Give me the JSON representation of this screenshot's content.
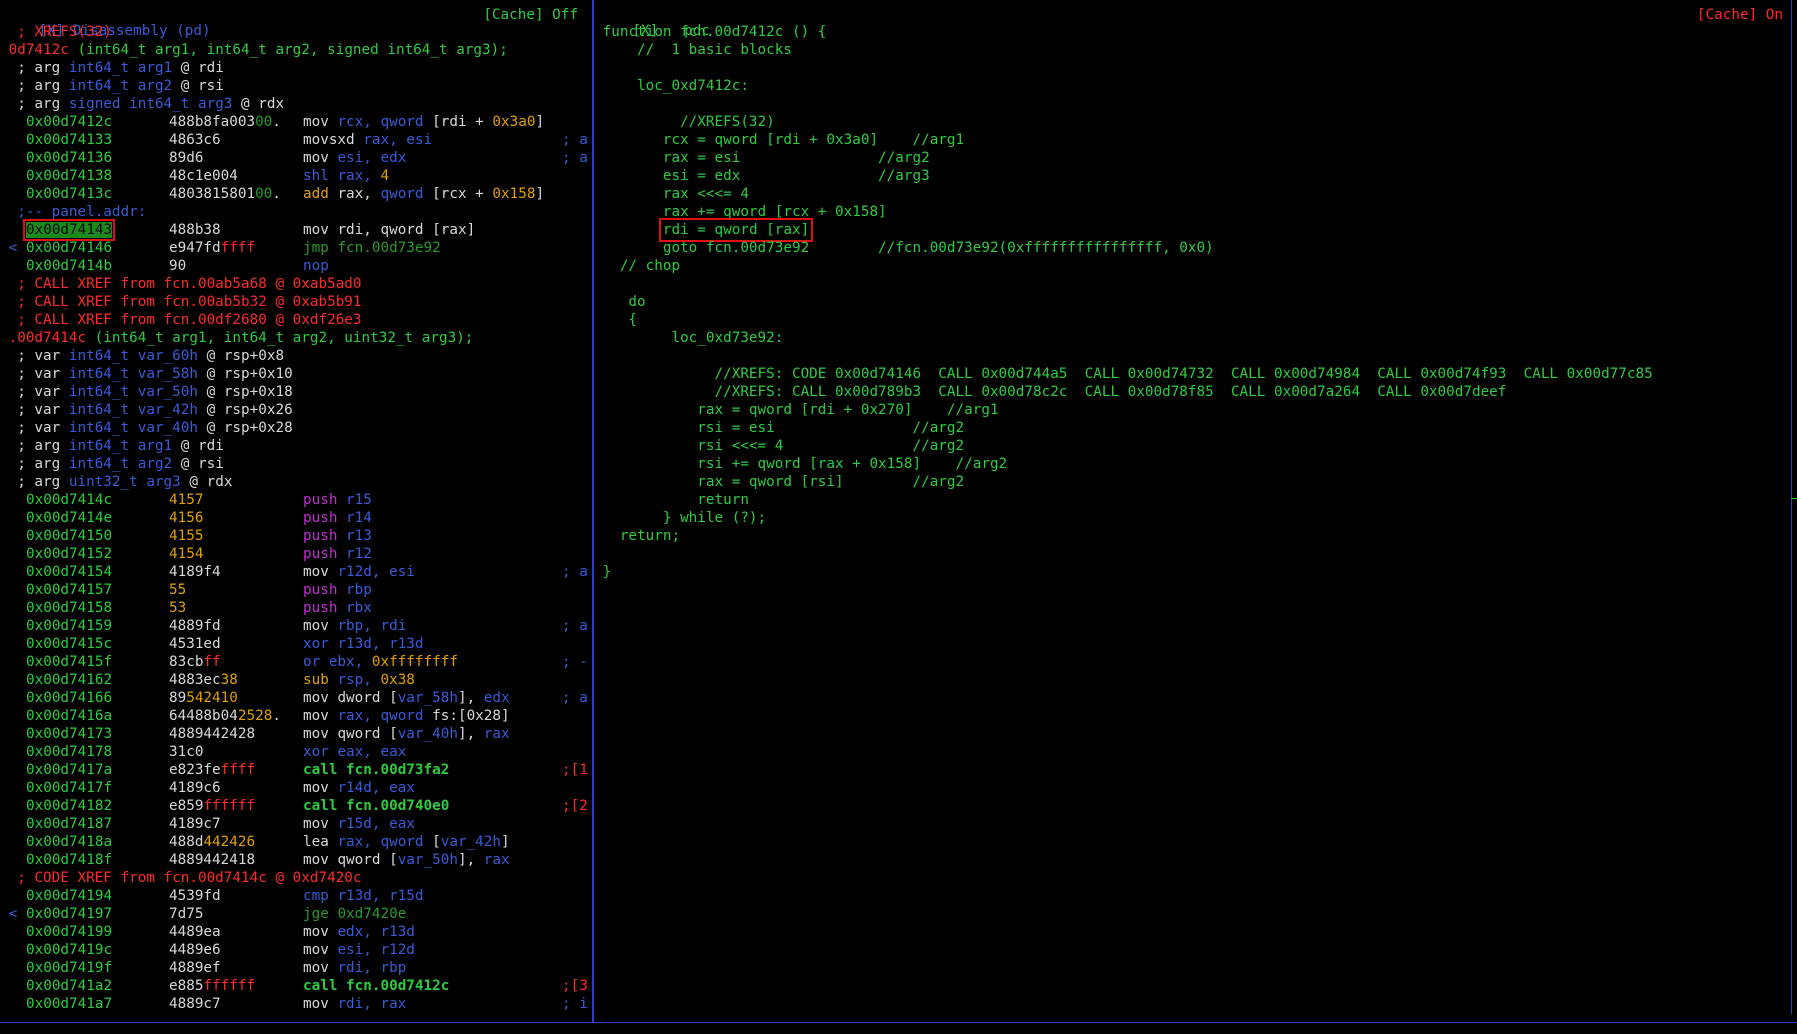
{
  "left_panel": {
    "title": "[X] Disassembly (pd)",
    "cache": "[Cache] Off",
    "lines": [
      {
        "t": "raw",
        "text": "  ; XREFS(32)",
        "c": "r"
      },
      {
        "t": "sig",
        "name": " 0d7412c",
        "rest": " (int64_t arg1, int64_t arg2, signed int64_t arg3);"
      },
      {
        "t": "arg",
        "pre": "  ; arg ",
        "typ": "int64_t arg1",
        "post": " @ rdi"
      },
      {
        "t": "arg",
        "pre": "  ; arg ",
        "typ": "int64_t arg2",
        "post": " @ rsi"
      },
      {
        "t": "arg",
        "pre": "  ; arg ",
        "typ": "signed int64_t arg3",
        "post": " @ rdx"
      },
      {
        "t": "ins",
        "mark": "",
        "addr": "0x00d7412c",
        "bytes": [
          [
            "488b8fa003",
            "w"
          ],
          [
            "00",
            "dg"
          ],
          [
            ".",
            "w"
          ]
        ],
        "op": [
          [
            "mov ",
            "w"
          ],
          [
            "rcx, ",
            "b"
          ],
          [
            "qword ",
            "b"
          ],
          [
            "[rdi + ",
            "w"
          ],
          [
            "0x3a0",
            "y"
          ],
          [
            "]",
            "w"
          ]
        ],
        "cm": ""
      },
      {
        "t": "ins",
        "mark": "",
        "addr": "0x00d74133",
        "bytes": [
          [
            "4863c6",
            "w"
          ]
        ],
        "op": [
          [
            "movsxd ",
            "w"
          ],
          [
            "rax, esi",
            "b"
          ]
        ],
        "cm": "; a"
      },
      {
        "t": "ins",
        "mark": "",
        "addr": "0x00d74136",
        "bytes": [
          [
            "89d6",
            "w"
          ]
        ],
        "op": [
          [
            "mov ",
            "w"
          ],
          [
            "esi, edx",
            "b"
          ]
        ],
        "cm": "; a"
      },
      {
        "t": "ins",
        "mark": "",
        "addr": "0x00d74138",
        "bytes": [
          [
            "48c1e004",
            "w"
          ]
        ],
        "op": [
          [
            "shl ",
            "b"
          ],
          [
            "rax, ",
            "b"
          ],
          [
            "4",
            "y"
          ]
        ],
        "cm": ""
      },
      {
        "t": "ins",
        "mark": "",
        "addr": "0x00d7413c",
        "bytes": [
          [
            "4803815801",
            "w"
          ],
          [
            "00",
            "dg"
          ],
          [
            ".",
            "w"
          ]
        ],
        "op": [
          [
            "add ",
            "y"
          ],
          [
            "rax, ",
            "w"
          ],
          [
            "qword ",
            "b"
          ],
          [
            "[rcx + ",
            "w"
          ],
          [
            "0x158",
            "y"
          ],
          [
            "]",
            "w"
          ]
        ],
        "cm": ""
      },
      {
        "t": "raw",
        "text": "  ;-- panel.addr:",
        "c": "b"
      },
      {
        "t": "ins",
        "mark": "",
        "addr": "0x00d74143",
        "sel": true,
        "bytes": [
          [
            "488b38",
            "w"
          ]
        ],
        "op": [
          [
            "mov ",
            "w"
          ],
          [
            "rdi, ",
            "w"
          ],
          [
            "qword ",
            "w"
          ],
          [
            "[rax]",
            "w"
          ]
        ],
        "cm": ""
      },
      {
        "t": "ins",
        "mark": "<",
        "addr": "0x00d74146",
        "bytes": [
          [
            "e947fd",
            "w"
          ],
          [
            "ffff",
            "r"
          ]
        ],
        "op": [
          [
            "jmp ",
            "dg"
          ],
          [
            "fcn.00d73e92",
            "dg"
          ]
        ],
        "cm": ""
      },
      {
        "t": "ins",
        "mark": "",
        "addr": "0x00d7414b",
        "bytes": [
          [
            "90",
            "w"
          ]
        ],
        "op": [
          [
            "nop",
            "b"
          ]
        ],
        "cm": ""
      },
      {
        "t": "raw",
        "text": "  ; CALL XREF from fcn.00ab5a68 @ 0xab5ad0",
        "c": "r"
      },
      {
        "t": "raw",
        "text": "  ; CALL XREF from fcn.00ab5b32 @ 0xab5b91",
        "c": "r"
      },
      {
        "t": "raw",
        "text": "  ; CALL XREF from fcn.00df2680 @ 0xdf26e3",
        "c": "r"
      },
      {
        "t": "sig",
        "name": " .00d7414c",
        "rest": " (int64_t arg1, int64_t arg2, uint32_t arg3);"
      },
      {
        "t": "arg",
        "pre": "  ; var ",
        "typ": "int64_t var_60h",
        "post": " @ rsp+0x8"
      },
      {
        "t": "arg",
        "pre": "  ; var ",
        "typ": "int64_t var_58h",
        "post": " @ rsp+0x10"
      },
      {
        "t": "arg",
        "pre": "  ; var ",
        "typ": "int64_t var_50h",
        "post": " @ rsp+0x18"
      },
      {
        "t": "arg",
        "pre": "  ; var ",
        "typ": "int64_t var_42h",
        "post": " @ rsp+0x26"
      },
      {
        "t": "arg",
        "pre": "  ; var ",
        "typ": "int64_t var_40h",
        "post": " @ rsp+0x28"
      },
      {
        "t": "arg",
        "pre": "  ; arg ",
        "typ": "int64_t arg1",
        "post": " @ rdi"
      },
      {
        "t": "arg",
        "pre": "  ; arg ",
        "typ": "int64_t arg2",
        "post": " @ rsi"
      },
      {
        "t": "arg",
        "pre": "  ; arg ",
        "typ": "uint32_t arg3",
        "post": " @ rdx"
      },
      {
        "t": "ins",
        "mark": "",
        "addr": "0x00d7414c",
        "bytes": [
          [
            "4157",
            "y"
          ]
        ],
        "op": [
          [
            "push ",
            "p"
          ],
          [
            "r15",
            "b"
          ]
        ],
        "cm": ""
      },
      {
        "t": "ins",
        "mark": "",
        "addr": "0x00d7414e",
        "bytes": [
          [
            "4156",
            "y"
          ]
        ],
        "op": [
          [
            "push ",
            "p"
          ],
          [
            "r14",
            "b"
          ]
        ],
        "cm": ""
      },
      {
        "t": "ins",
        "mark": "",
        "addr": "0x00d74150",
        "bytes": [
          [
            "4155",
            "y"
          ]
        ],
        "op": [
          [
            "push ",
            "p"
          ],
          [
            "r13",
            "b"
          ]
        ],
        "cm": ""
      },
      {
        "t": "ins",
        "mark": "",
        "addr": "0x00d74152",
        "bytes": [
          [
            "4154",
            "y"
          ]
        ],
        "op": [
          [
            "push ",
            "p"
          ],
          [
            "r12",
            "b"
          ]
        ],
        "cm": ""
      },
      {
        "t": "ins",
        "mark": "",
        "addr": "0x00d74154",
        "bytes": [
          [
            "4189f4",
            "w"
          ]
        ],
        "op": [
          [
            "mov ",
            "w"
          ],
          [
            "r12d, esi",
            "b"
          ]
        ],
        "cm": "; a"
      },
      {
        "t": "ins",
        "mark": "",
        "addr": "0x00d74157",
        "bytes": [
          [
            "55",
            "y"
          ]
        ],
        "op": [
          [
            "push ",
            "p"
          ],
          [
            "rbp",
            "b"
          ]
        ],
        "cm": ""
      },
      {
        "t": "ins",
        "mark": "",
        "addr": "0x00d74158",
        "bytes": [
          [
            "53",
            "y"
          ]
        ],
        "op": [
          [
            "push ",
            "p"
          ],
          [
            "rbx",
            "b"
          ]
        ],
        "cm": ""
      },
      {
        "t": "ins",
        "mark": "",
        "addr": "0x00d74159",
        "bytes": [
          [
            "4889fd",
            "w"
          ]
        ],
        "op": [
          [
            "mov ",
            "w"
          ],
          [
            "rbp, rdi",
            "b"
          ]
        ],
        "cm": "; a"
      },
      {
        "t": "ins",
        "mark": "",
        "addr": "0x00d7415c",
        "bytes": [
          [
            "4531ed",
            "w"
          ]
        ],
        "op": [
          [
            "xor ",
            "b"
          ],
          [
            "r13d, r13d",
            "b"
          ]
        ],
        "cm": ""
      },
      {
        "t": "ins",
        "mark": "",
        "addr": "0x00d7415f",
        "bytes": [
          [
            "83cb",
            "w"
          ],
          [
            "ff",
            "r"
          ]
        ],
        "op": [
          [
            "or ",
            "b"
          ],
          [
            "ebx, ",
            "b"
          ],
          [
            "0xffffffff",
            "y"
          ]
        ],
        "cm": "; -"
      },
      {
        "t": "ins",
        "mark": "",
        "addr": "0x00d74162",
        "bytes": [
          [
            "4883ec",
            "w"
          ],
          [
            "38",
            "y"
          ]
        ],
        "op": [
          [
            "sub ",
            "y"
          ],
          [
            "rsp, ",
            "b"
          ],
          [
            "0x38",
            "y"
          ]
        ],
        "cm": ""
      },
      {
        "t": "ins",
        "mark": "",
        "addr": "0x00d74166",
        "bytes": [
          [
            "89",
            "w"
          ],
          [
            "542410",
            "y"
          ]
        ],
        "op": [
          [
            "mov ",
            "w"
          ],
          [
            "dword ",
            "w"
          ],
          [
            "[",
            "w"
          ],
          [
            "var_58h",
            "b"
          ],
          [
            "], ",
            "w"
          ],
          [
            "edx",
            "b"
          ]
        ],
        "cm": "; a"
      },
      {
        "t": "ins",
        "mark": "",
        "addr": "0x00d7416a",
        "bytes": [
          [
            "64488b04",
            "w"
          ],
          [
            "2528",
            "y"
          ],
          [
            ".",
            "w"
          ]
        ],
        "op": [
          [
            "mov ",
            "w"
          ],
          [
            "rax, ",
            "b"
          ],
          [
            "qword ",
            "b"
          ],
          [
            "fs:[0x28]",
            "w"
          ]
        ],
        "cm": ""
      },
      {
        "t": "ins",
        "mark": "",
        "addr": "0x00d74173",
        "bytes": [
          [
            "4889442428",
            "w"
          ]
        ],
        "op": [
          [
            "mov ",
            "w"
          ],
          [
            "qword ",
            "w"
          ],
          [
            "[",
            "w"
          ],
          [
            "var_40h",
            "b"
          ],
          [
            "], ",
            "w"
          ],
          [
            "rax",
            "b"
          ]
        ],
        "cm": ""
      },
      {
        "t": "ins",
        "mark": "",
        "addr": "0x00d74178",
        "bytes": [
          [
            "31c0",
            "w"
          ]
        ],
        "op": [
          [
            "xor ",
            "b"
          ],
          [
            "eax, eax",
            "b"
          ]
        ],
        "cm": ""
      },
      {
        "t": "ins",
        "mark": "",
        "addr": "0x00d7417a",
        "bytes": [
          [
            "e823fe",
            "w"
          ],
          [
            "ffff",
            "r"
          ]
        ],
        "op": [
          [
            "call ",
            "call"
          ],
          [
            "fcn.00d73fa2",
            "call"
          ]
        ],
        "cm": ";[1",
        "cmr": true
      },
      {
        "t": "ins",
        "mark": "",
        "addr": "0x00d7417f",
        "bytes": [
          [
            "4189c6",
            "w"
          ]
        ],
        "op": [
          [
            "mov ",
            "w"
          ],
          [
            "r14d, eax",
            "b"
          ]
        ],
        "cm": ""
      },
      {
        "t": "ins",
        "mark": "",
        "addr": "0x00d74182",
        "bytes": [
          [
            "e859",
            "w"
          ],
          [
            "ffffff",
            "r"
          ]
        ],
        "op": [
          [
            "call ",
            "call"
          ],
          [
            "fcn.00d740e0",
            "call"
          ]
        ],
        "cm": ";[2",
        "cmr": true
      },
      {
        "t": "ins",
        "mark": "",
        "addr": "0x00d74187",
        "bytes": [
          [
            "4189c7",
            "w"
          ]
        ],
        "op": [
          [
            "mov ",
            "w"
          ],
          [
            "r15d, eax",
            "b"
          ]
        ],
        "cm": ""
      },
      {
        "t": "ins",
        "mark": "",
        "addr": "0x00d7418a",
        "bytes": [
          [
            "488d",
            "w"
          ],
          [
            "442426",
            "y"
          ]
        ],
        "op": [
          [
            "lea ",
            "w"
          ],
          [
            "rax, ",
            "b"
          ],
          [
            "qword ",
            "b"
          ],
          [
            "[",
            "w"
          ],
          [
            "var_42h",
            "b"
          ],
          [
            "]",
            "w"
          ]
        ],
        "cm": ""
      },
      {
        "t": "ins",
        "mark": "",
        "addr": "0x00d7418f",
        "bytes": [
          [
            "4889442418",
            "w"
          ]
        ],
        "op": [
          [
            "mov ",
            "w"
          ],
          [
            "qword ",
            "w"
          ],
          [
            "[",
            "w"
          ],
          [
            "var_50h",
            "b"
          ],
          [
            "], ",
            "w"
          ],
          [
            "rax",
            "b"
          ]
        ],
        "cm": ""
      },
      {
        "t": "raw",
        "text": "  ; CODE XREF from fcn.00d7414c @ 0xd7420c",
        "c": "r"
      },
      {
        "t": "ins",
        "mark": "",
        "addr": "0x00d74194",
        "bytes": [
          [
            "4539fd",
            "w"
          ]
        ],
        "op": [
          [
            "cmp ",
            "b"
          ],
          [
            "r13d, r15d",
            "b"
          ]
        ],
        "cm": ""
      },
      {
        "t": "ins",
        "mark": "<",
        "addr": "0x00d74197",
        "bytes": [
          [
            "7d75",
            "w"
          ]
        ],
        "op": [
          [
            "jge ",
            "dg"
          ],
          [
            "0xd7420e",
            "dg"
          ]
        ],
        "cm": ""
      },
      {
        "t": "ins",
        "mark": "",
        "addr": "0x00d74199",
        "bytes": [
          [
            "4489ea",
            "w"
          ]
        ],
        "op": [
          [
            "mov ",
            "w"
          ],
          [
            "edx, r13d",
            "b"
          ]
        ],
        "cm": ""
      },
      {
        "t": "ins",
        "mark": "",
        "addr": "0x00d7419c",
        "bytes": [
          [
            "4489e6",
            "w"
          ]
        ],
        "op": [
          [
            "mov ",
            "w"
          ],
          [
            "esi, r12d",
            "b"
          ]
        ],
        "cm": ""
      },
      {
        "t": "ins",
        "mark": "",
        "addr": "0x00d7419f",
        "bytes": [
          [
            "4889ef",
            "w"
          ]
        ],
        "op": [
          [
            "mov ",
            "w"
          ],
          [
            "rdi, rbp",
            "b"
          ]
        ],
        "cm": ""
      },
      {
        "t": "ins",
        "mark": "",
        "addr": "0x00d741a2",
        "bytes": [
          [
            "e885",
            "w"
          ],
          [
            "ffffff",
            "r"
          ]
        ],
        "op": [
          [
            "call ",
            "call"
          ],
          [
            "fcn.00d7412c",
            "call"
          ]
        ],
        "cm": ";[3",
        "cmr": true
      },
      {
        "t": "ins",
        "mark": "",
        "addr": "0x00d741a7",
        "bytes": [
          [
            "4889c7",
            "w"
          ]
        ],
        "op": [
          [
            "mov ",
            "w"
          ],
          [
            "rdi, rax",
            "b"
          ]
        ],
        "cm": "; i"
      }
    ]
  },
  "right_panel": {
    "title": "[X]   pdc",
    "cache": "[Cache] On",
    "lines": [
      {
        "text": " function fcn.00d7412c () {"
      },
      {
        "text": "     //  1 basic blocks"
      },
      {
        "text": ""
      },
      {
        "text": "     loc_0xd7412c:"
      },
      {
        "text": ""
      },
      {
        "text": "          //XREFS(32)"
      },
      {
        "text": "        rcx = qword [rdi + 0x3a0]    //arg1"
      },
      {
        "text": "        rax = esi                //arg2"
      },
      {
        "text": "        esi = edx                //arg3"
      },
      {
        "text": "        rax <<<= 4"
      },
      {
        "text": "        rax += qword [rcx + 0x158]"
      },
      {
        "text": "        rdi = qword [rax]",
        "box": true
      },
      {
        "text": "        goto fcn.00d73e92        //fcn.00d73e92(0xffffffffffffffff, 0x0)"
      },
      {
        "text": "   // chop"
      },
      {
        "text": ""
      },
      {
        "text": "    do"
      },
      {
        "text": "    {"
      },
      {
        "text": "         loc_0xd73e92:"
      },
      {
        "text": ""
      },
      {
        "text": "              //XREFS: CODE 0x00d74146  CALL 0x00d744a5  CALL 0x00d74732  CALL 0x00d74984  CALL 0x00d74f93  CALL 0x00d77c85"
      },
      {
        "text": "              //XREFS: CALL 0x00d789b3  CALL 0x00d78c2c  CALL 0x00d78f85  CALL 0x00d7a264  CALL 0x00d7deef"
      },
      {
        "text": "            rax = qword [rdi + 0x270]    //arg1"
      },
      {
        "text": "            rsi = esi                //arg2"
      },
      {
        "text": "            rsi <<<= 4               //arg2"
      },
      {
        "text": "            rsi += qword [rax + 0x158]    //arg2"
      },
      {
        "text": "            rax = qword [rsi]        //arg2"
      },
      {
        "text": "            return"
      },
      {
        "text": "        } while (?);"
      },
      {
        "text": "   return;"
      },
      {
        "text": ""
      },
      {
        "text": " }"
      }
    ]
  }
}
